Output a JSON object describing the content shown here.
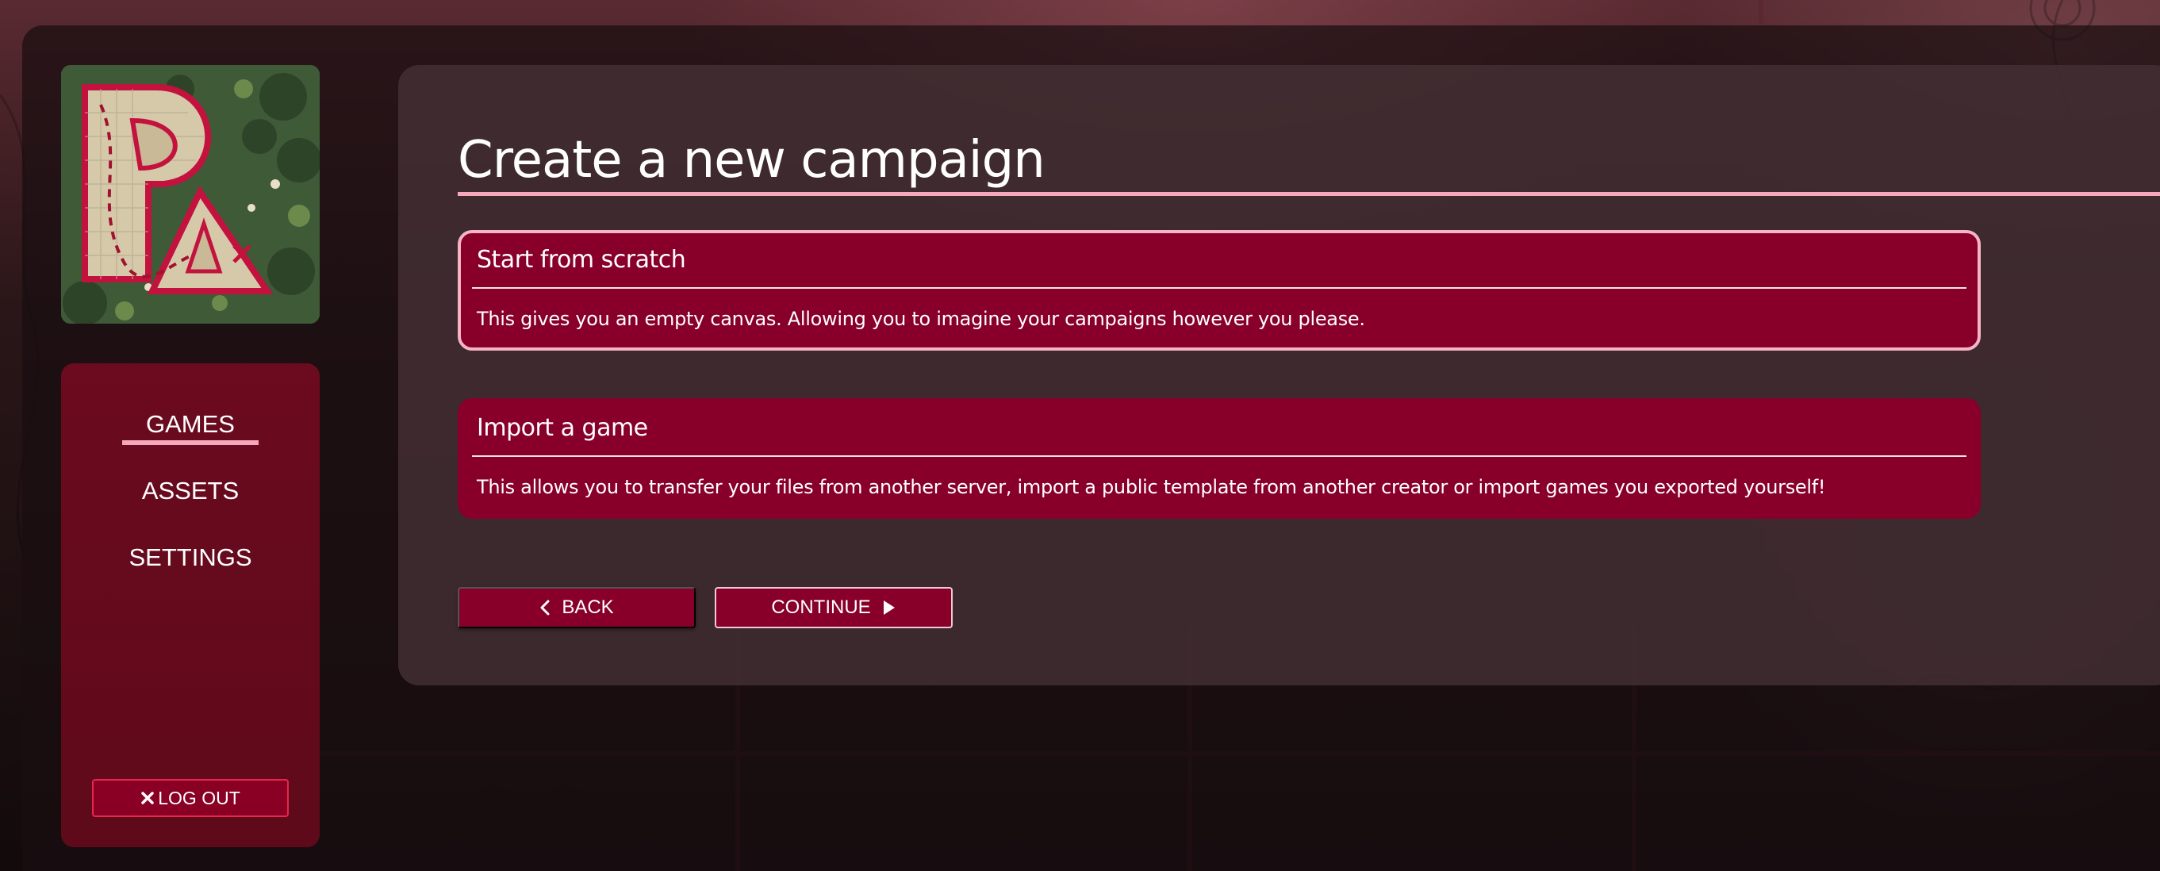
{
  "nav": {
    "items": [
      {
        "label": "GAMES",
        "active": true
      },
      {
        "label": "ASSETS",
        "active": false
      },
      {
        "label": "SETTINGS",
        "active": false
      }
    ],
    "logout_label": "LOG OUT"
  },
  "main": {
    "title": "Create a new campaign",
    "options": [
      {
        "title": "Start from scratch",
        "description": "This gives you an empty canvas. Allowing you to imagine your campaigns however you please.",
        "selected": true
      },
      {
        "title": "Import a game",
        "description": "This allows you to transfer your files from another server, import a public template from another creator or import games you exported yourself!",
        "selected": false
      }
    ],
    "back_label": "BACK",
    "continue_label": "CONTINUE"
  },
  "icons": {
    "logo": "pa-map-logo",
    "logout": "close-icon",
    "back": "chevron-left-icon",
    "continue": "play-icon"
  },
  "colors": {
    "accent": "#88002a",
    "accent_light": "#f5a8bb",
    "sidebar": "#6c0a1f",
    "panel": "#443034",
    "text": "#ffffff"
  }
}
